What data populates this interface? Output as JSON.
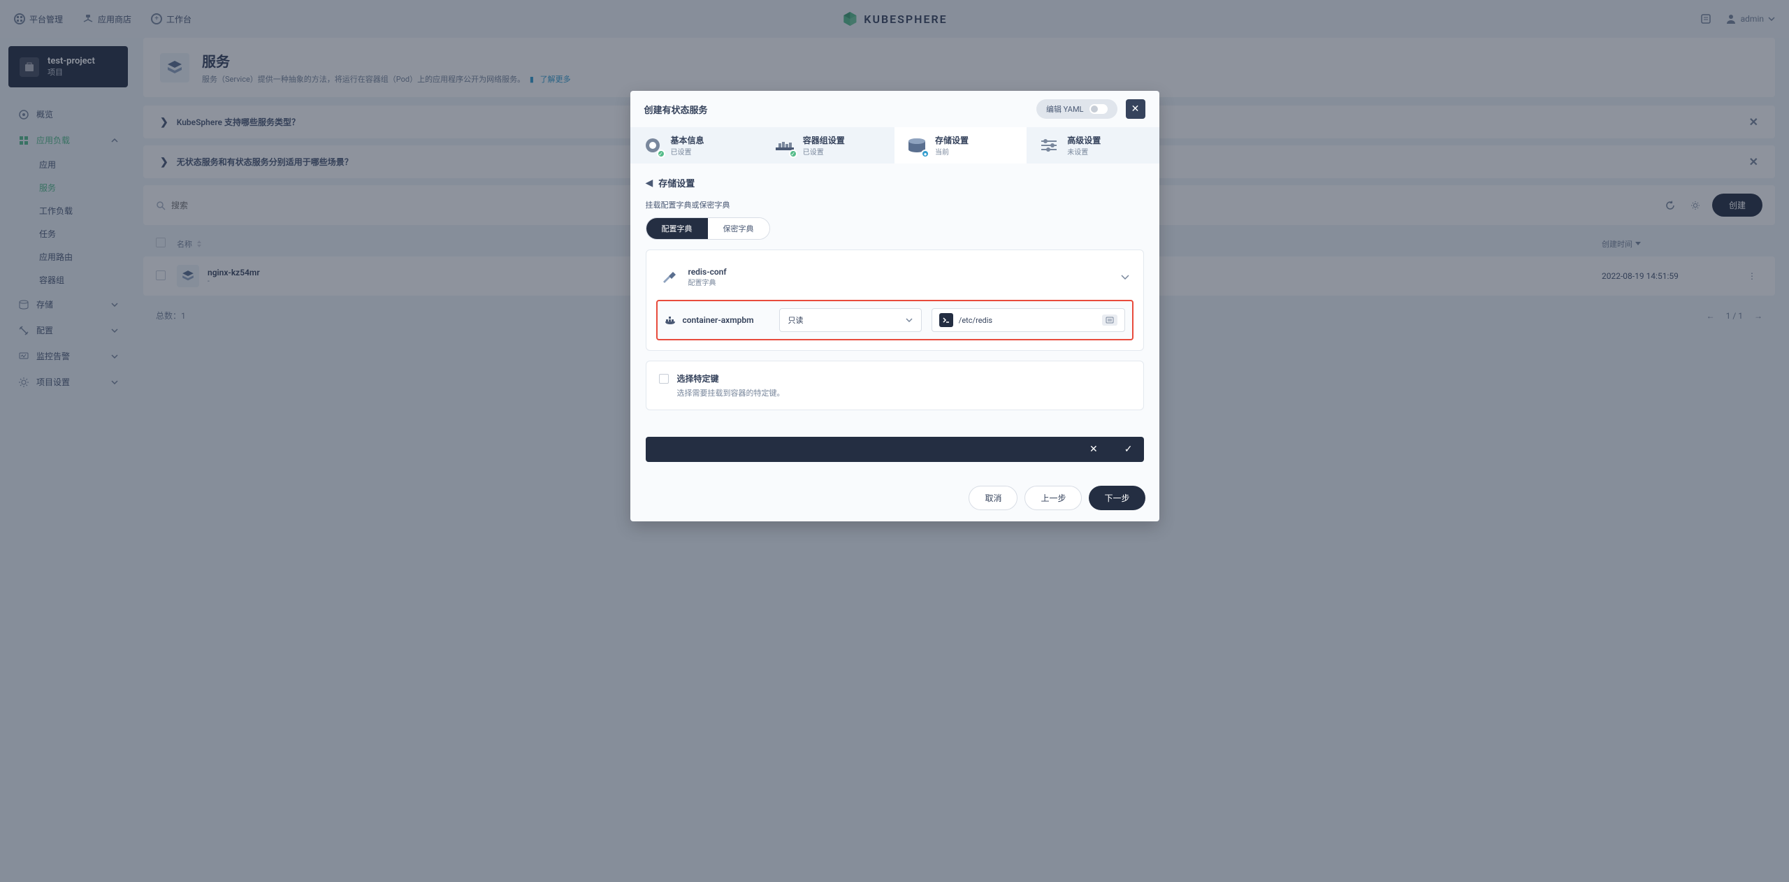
{
  "header": {
    "platform": "平台管理",
    "appstore": "应用商店",
    "workbench": "工作台",
    "brand": "KUBESPHERE",
    "user": "admin"
  },
  "sidebar": {
    "project_name": "test-project",
    "project_sub": "项目",
    "nav": {
      "overview": "概览",
      "workload": "应用负载",
      "subs": {
        "app": "应用",
        "service": "服务",
        "workloads": "工作负载",
        "jobs": "任务",
        "routes": "应用路由",
        "pods": "容器组"
      },
      "storage": "存储",
      "config": "配置",
      "monitor": "监控告警",
      "settings": "项目设置"
    }
  },
  "page": {
    "title": "服务",
    "desc": "服务（Service）提供一种抽象的方法，将运行在容器组（Pod）上的应用程序公开为网络服务。",
    "learn_more": "了解更多",
    "accordion1": "KubeSphere 支持哪些服务类型？",
    "accordion2": "无状态服务和有状态服务分别适用于哪些场景？",
    "search_placeholder": "搜索",
    "create": "创建",
    "col_name": "名称",
    "col_time": "创建时间",
    "row": {
      "name": "nginx-kz54mr",
      "sub": "-",
      "time": "2022-08-19 14:51:59"
    },
    "total_label": "总数：",
    "total_count": "1",
    "pager": "1 / 1"
  },
  "modal": {
    "title": "创建有状态服务",
    "yaml_label": "编辑 YAML",
    "steps": {
      "s1": {
        "title": "基本信息",
        "sub": "已设置"
      },
      "s2": {
        "title": "容器组设置",
        "sub": "已设置"
      },
      "s3": {
        "title": "存储设置",
        "sub": "当前"
      },
      "s4": {
        "title": "高级设置",
        "sub": "未设置"
      }
    },
    "body_title": "存储设置",
    "mount_label": "挂载配置字典或保密字典",
    "pill_config": "配置字典",
    "pill_secret": "保密字典",
    "config": {
      "name": "redis-conf",
      "sub": "配置字典"
    },
    "container": {
      "name": "container-axmpbm",
      "readonly": "只读",
      "path": "/etc/redis"
    },
    "keysel": {
      "title": "选择特定键",
      "desc": "选择需要挂载到容器的特定键。"
    },
    "buttons": {
      "cancel": "取消",
      "prev": "上一步",
      "next": "下一步"
    }
  }
}
